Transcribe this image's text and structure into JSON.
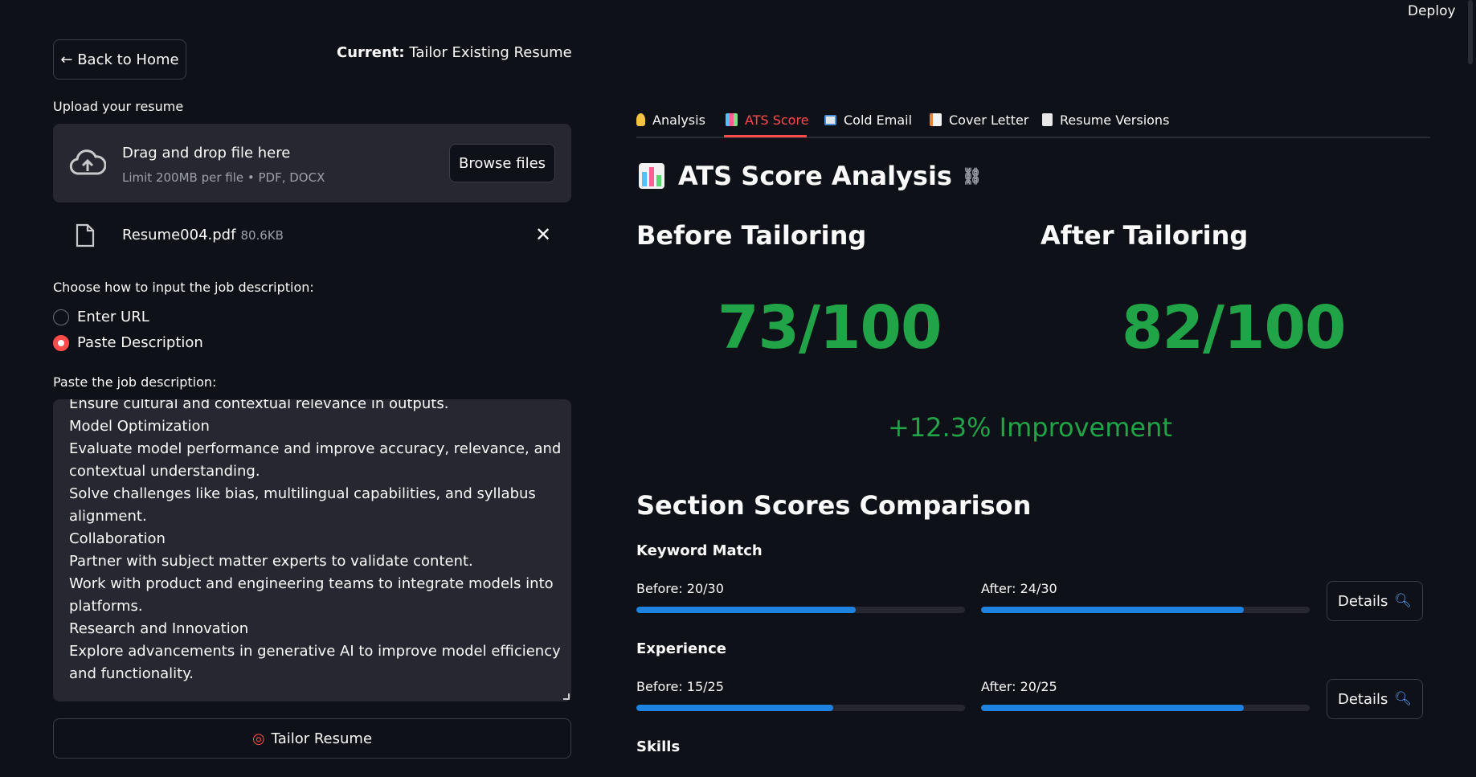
{
  "header": {
    "deploy_label": "Deploy"
  },
  "sidebar_controls": {
    "back_label": "← Back to Home",
    "current_prefix": "Current:",
    "current_value": "Tailor Existing Resume"
  },
  "upload": {
    "label": "Upload your resume",
    "drag_text": "Drag and drop file here",
    "limit_text": "Limit 200MB per file • PDF, DOCX",
    "browse_label": "Browse files",
    "file_name": "Resume004.pdf",
    "file_size": "80.6KB",
    "remove_glyph": "✕"
  },
  "input_mode": {
    "label": "Choose how to input the job description:",
    "options": [
      {
        "label": "Enter URL",
        "selected": false
      },
      {
        "label": "Paste Description",
        "selected": true
      }
    ]
  },
  "job_description": {
    "label": "Paste the job description:",
    "lines": [
      "Ensure cultural and contextual relevance in outputs.",
      "Model Optimization",
      "Evaluate model performance and improve accuracy, relevance, and",
      "contextual understanding.",
      "Solve challenges like bias, multilingual capabilities, and syllabus",
      "alignment.",
      "Collaboration",
      "Partner with subject matter experts to validate content.",
      "Work with product and engineering teams to integrate models into",
      "platforms.",
      "Research and Innovation",
      "Explore advancements in generative AI to improve model efficiency",
      "and functionality."
    ]
  },
  "tailor_button": {
    "label": "Tailor Resume"
  },
  "tabs": [
    {
      "label": "Analysis",
      "icon": "lightbulb-icon",
      "active": false
    },
    {
      "label": "ATS Score",
      "icon": "chart-icon",
      "active": true
    },
    {
      "label": "Cold Email",
      "icon": "email-icon",
      "active": false
    },
    {
      "label": "Cover Letter",
      "icon": "memo-icon",
      "active": false
    },
    {
      "label": "Resume Versions",
      "icon": "document-icon",
      "active": false
    }
  ],
  "ats": {
    "title": "ATS Score Analysis",
    "before_heading": "Before Tailoring",
    "after_heading": "After Tailoring",
    "before_score": "73/100",
    "after_score": "82/100",
    "improvement": "+12.3% Improvement",
    "score_color": "#21a347"
  },
  "sections": {
    "heading": "Section Scores Comparison",
    "details_label": "Details",
    "items": [
      {
        "name": "Keyword Match",
        "before_label": "Before: 20/30",
        "after_label": "After: 24/30",
        "before_fraction": 0.667,
        "after_fraction": 0.8
      },
      {
        "name": "Experience",
        "before_label": "Before: 15/25",
        "after_label": "After: 20/25",
        "before_fraction": 0.6,
        "after_fraction": 0.8
      },
      {
        "name": "Skills"
      }
    ]
  },
  "colors": {
    "accent": "#ff4b4b",
    "progress": "#1c83e1",
    "background": "#0e1117",
    "panel": "#262730"
  }
}
